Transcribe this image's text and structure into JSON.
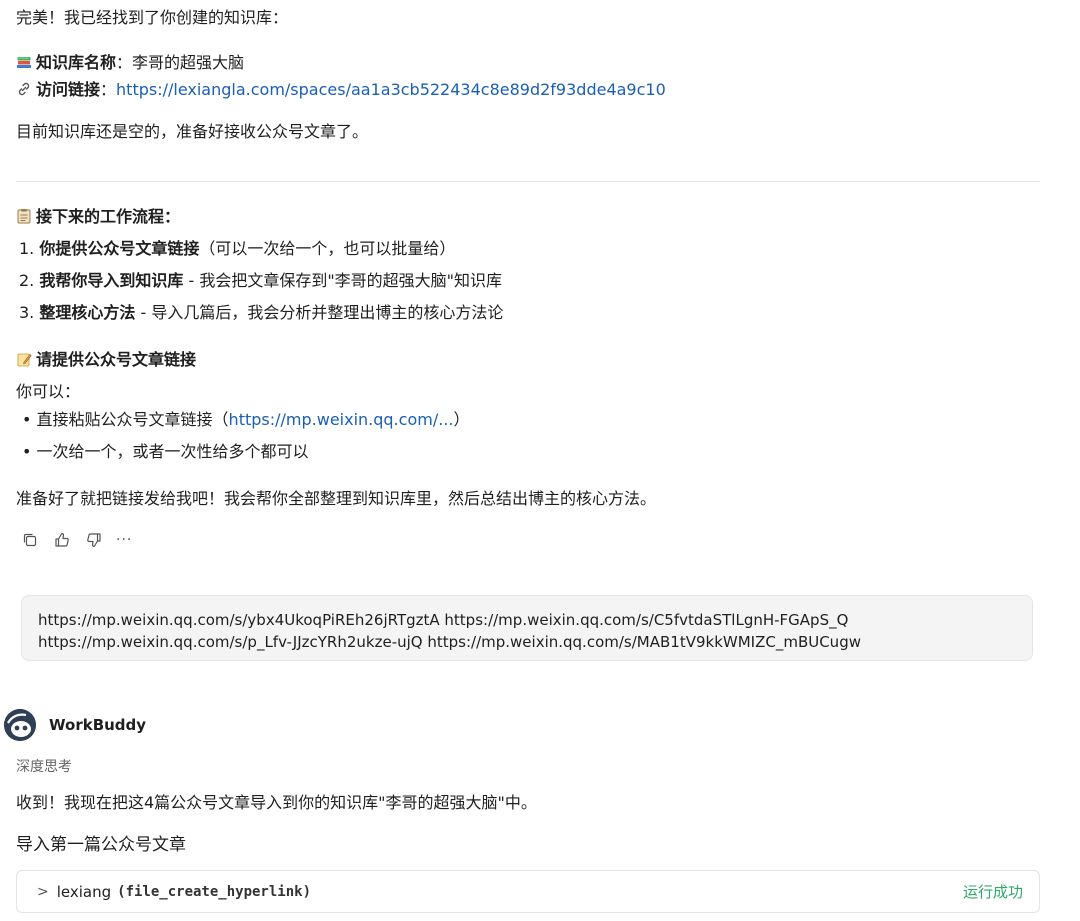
{
  "message": {
    "intro": "完美！我已经找到了你创建的知识库：",
    "kb_name_label": "知识库名称",
    "kb_name_sep": "：",
    "kb_name_value": "李哥的超强大脑",
    "kb_link_label": "访问链接",
    "kb_link_sep": "：",
    "kb_link_url": "https://lexiangla.com/spaces/aa1a3cb522434c8e89d2f93dde4a9c10",
    "kb_empty_note": "目前知识库还是空的，准备好接收公众号文章了。",
    "workflow_title": "接下来的工作流程：",
    "steps": [
      {
        "num": "1.",
        "bold": "你提供公众号文章链接",
        "rest": "（可以一次给一个，也可以批量给）"
      },
      {
        "num": "2.",
        "bold": "我帮你导入到知识库",
        "rest": " - 我会把文章保存到\"李哥的超强大脑\"知识库"
      },
      {
        "num": "3.",
        "bold": "整理核心方法",
        "rest": " - 导入几篇后，我会分析并整理出博主的核心方法论"
      }
    ],
    "request_title": "请提供公众号文章链接",
    "you_can": "你可以：",
    "bullets": [
      {
        "pre": "直接粘贴公众号文章链接（",
        "link": "https://mp.weixin.qq.com/...",
        "post": "）"
      },
      {
        "pre": "一次给一个，或者一次性给多个都可以",
        "link": "",
        "post": ""
      }
    ],
    "closing": "准备好了就把链接发给我吧！我会帮你全部整理到知识库里，然后总结出博主的核心方法。"
  },
  "actions": {
    "more": "···"
  },
  "user_message": {
    "line1": "https://mp.weixin.qq.com/s/ybx4UkoqPiREh26jRTgztA https://mp.weixin.qq.com/s/C5fvtdaSTlLgnH-FGApS_Q",
    "line2": "https://mp.weixin.qq.com/s/p_Lfv-JJzcYRh2ukze-ujQ https://mp.weixin.qq.com/s/MAB1tV9kkWMIZC_mBUCugw"
  },
  "agent": {
    "name": "WorkBuddy",
    "thinking_label": "深度思考",
    "reply": "收到！我现在把这4篇公众号文章导入到你的知识库\"李哥的超强大脑\"中。",
    "section_title": "导入第一篇公众号文章",
    "tool_call": {
      "chevron": ">",
      "name": "lexiang",
      "fn": "(file_create_hyperlink)",
      "status": "运行成功"
    }
  },
  "colors": {
    "link": "#1a5fb4",
    "success": "#2fa86a",
    "bubble_bg": "#f4f4f4",
    "divider": "#e5e5e5"
  }
}
